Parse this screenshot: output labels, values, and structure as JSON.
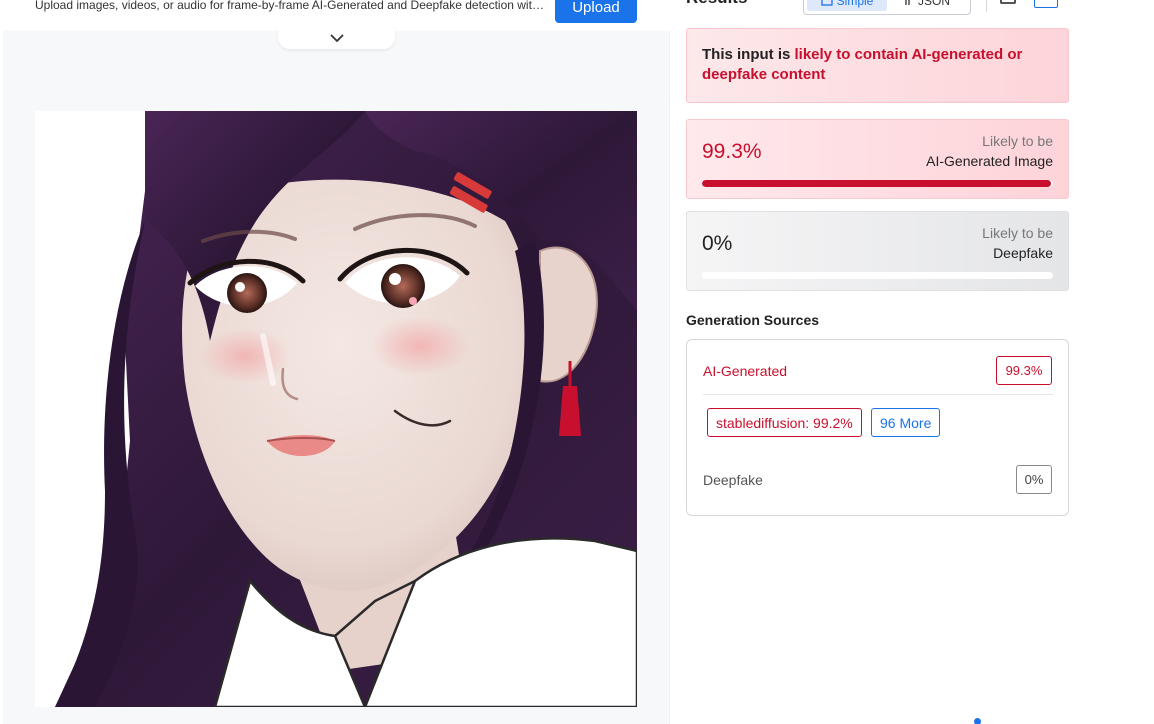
{
  "upload": {
    "description": "Upload images, videos, or audio for frame-by-frame AI-Generated and Deepfake detection with...",
    "button_label": "Upload"
  },
  "image": {
    "subject": "anime-style portrait of a girl with long dark purple hair"
  },
  "results": {
    "title": "Results",
    "view_toggle": {
      "simple_label": "Simple",
      "json_label": "JSON"
    },
    "verdict": {
      "prefix": "This input is ",
      "highlight": "likely to contain AI-generated or deepfake content"
    },
    "ai_score": {
      "percent_label": "99.3%",
      "value": 0.993,
      "line1": "Likely to be",
      "line2": "AI-Generated Image"
    },
    "deepfake_score": {
      "percent_label": "0%",
      "value": 0,
      "line1": "Likely to be",
      "line2": "Deepfake"
    },
    "generation_sources": {
      "title": "Generation Sources",
      "ai_label": "AI-Generated",
      "ai_badge": "99.3%",
      "source_chip": "stablediffusion: 99.2%",
      "more_chip": "96 More",
      "deepfake_label": "Deepfake",
      "deepfake_badge": "0%"
    }
  },
  "colors": {
    "accent_blue": "#1a73e8",
    "danger_red": "#c8102e"
  },
  "icons": [
    "chevron-down-icon",
    "simple-view-icon",
    "json-view-icon",
    "download-icon",
    "expand-icon"
  ]
}
